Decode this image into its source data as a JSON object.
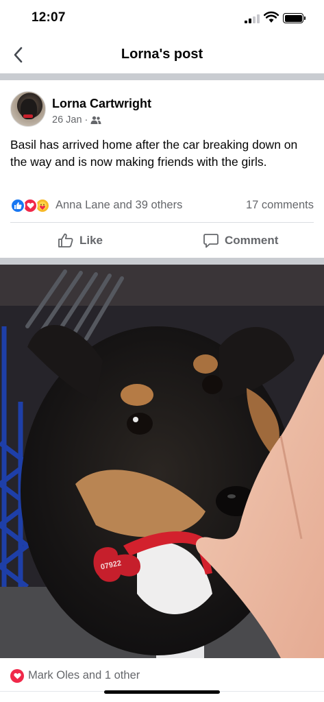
{
  "status_bar": {
    "time": "12:07"
  },
  "nav": {
    "title": "Lorna's post",
    "back_icon": "chevron-left-icon"
  },
  "post": {
    "author": "Lorna Cartwright",
    "date": "26 Jan",
    "separator": "·",
    "audience_icon": "friends-icon",
    "text": "Basil has arrived home after the car breaking down on the way and is now making friends with the girls.",
    "reactions": {
      "icons": [
        "like-icon",
        "love-icon",
        "care-icon"
      ],
      "names": "Anna Lane and 39 others",
      "comments": "17 comments"
    },
    "actions": {
      "like_label": "Like",
      "comment_label": "Comment"
    },
    "photo_tag_text": "07922"
  },
  "photo_reactions": {
    "icon": "love-icon",
    "names": "Mark Oles and 1 other"
  },
  "colors": {
    "like_blue": "#1877f2",
    "love_red": "#f02849",
    "care_yellow": "#f7b928",
    "secondary_text": "#65676b",
    "divider": "#c9ccd1"
  }
}
